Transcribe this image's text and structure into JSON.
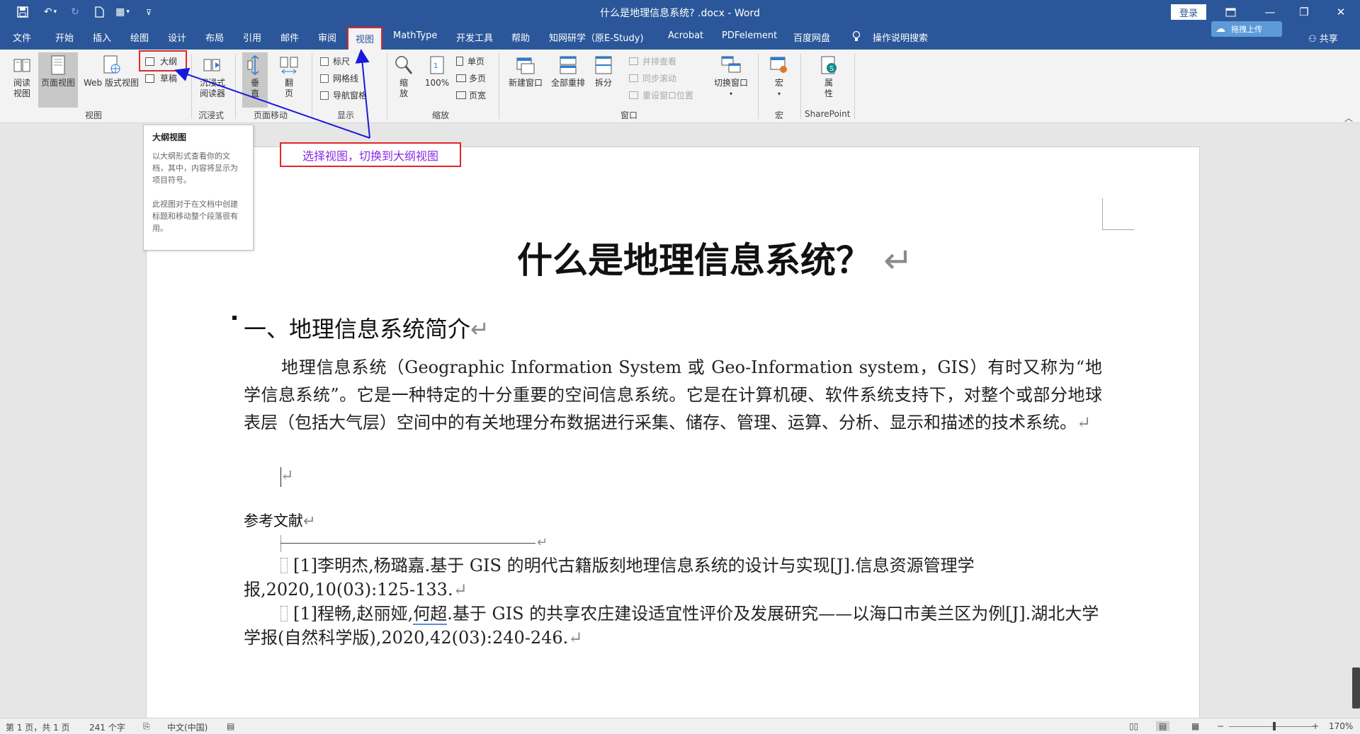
{
  "window": {
    "title": "什么是地理信息系统? .docx - Word",
    "login_label": "登录",
    "upload_label": "拖拽上传",
    "share_label": "共享"
  },
  "tabs": [
    {
      "label": "文件"
    },
    {
      "label": "开始"
    },
    {
      "label": "插入"
    },
    {
      "label": "绘图"
    },
    {
      "label": "设计"
    },
    {
      "label": "布局"
    },
    {
      "label": "引用"
    },
    {
      "label": "邮件"
    },
    {
      "label": "审阅"
    },
    {
      "label": "视图",
      "active": true
    },
    {
      "label": "MathType"
    },
    {
      "label": "开发工具"
    },
    {
      "label": "帮助"
    },
    {
      "label": "知网研学（原E-Study)"
    },
    {
      "label": "Acrobat"
    },
    {
      "label": "PDFelement"
    },
    {
      "label": "百度网盘"
    },
    {
      "label": "操作说明搜索"
    }
  ],
  "ribbon": {
    "views": {
      "read_mode": "阅读视图",
      "print_layout": "页面视图",
      "web_layout": "Web 版式视图",
      "outline": "大纲",
      "draft": "草稿",
      "group": "视图"
    },
    "immersive": {
      "reader": "沉浸式阅读器",
      "group": "沉浸式"
    },
    "page_movement": {
      "vertical": "垂直",
      "side_to_side": "翻页",
      "group": "页面移动"
    },
    "show": {
      "ruler": "标尺",
      "gridlines": "网格线",
      "nav_pane": "导航窗格",
      "group": "显示"
    },
    "zoom": {
      "zoom": "缩放",
      "hundred": "100%",
      "one_page": "单页",
      "multi_page": "多页",
      "page_width": "页宽",
      "group": "缩放"
    },
    "window": {
      "new_window": "新建窗口",
      "arrange_all": "全部重排",
      "split": "拆分",
      "side_by_side": "并排查看",
      "sync_scroll": "同步滚动",
      "reset_pos": "重设窗口位置",
      "switch_windows": "切换窗口",
      "group": "窗口"
    },
    "macros": {
      "macros": "宏",
      "group": "宏"
    },
    "sharepoint": {
      "properties": "属性",
      "group": "SharePoint"
    }
  },
  "tooltip": {
    "title": "大纲视图",
    "body1": "以大纲形式查看你的文档，其中，内容将显示为项目符号。",
    "body2": "此视图对于在文档中创建标题和移动整个段落很有用。"
  },
  "callout": "选择视图，切换到大纲视图",
  "document": {
    "title": "什么是地理信息系统？",
    "heading": "一、地理信息系统简介",
    "paragraph": "地理信息系统（Geographic Information System 或 Geo-Information system，GIS）有时又称为“地学信息系统”。它是一种特定的十分重要的空间信息系统。它是在计算机硬、软件系统支持下，对整个或部分地球表层（包括大气层）空间中的有关地理分布数据进行采集、储存、管理、运算、分析、显示和描述的技术系统。",
    "ref_heading": "参考文献",
    "ref1": "[1]李明杰,杨璐嘉.基于 GIS 的明代古籍版刻地理信息系统的设计与实现[J].信息资源管理学报,2020,10(03):125-133.",
    "ref2_pre": "[1]程畅,赵丽娅,",
    "ref2_under": "何超",
    "ref2_post": ".基于 GIS 的共享农庄建设适宜性评价及发展研究——以海口市美兰区为例[J].湖北大学学报(自然科学版),2020,42(03):240-246."
  },
  "status": {
    "page": "第 1 页，共 1 页",
    "words": "241 个字",
    "language": "中文(中国)",
    "zoom": "170%"
  },
  "colors": {
    "accent": "#2b579a",
    "highlight": "#e0262b",
    "callout_text": "#8a2be2",
    "arrow": "#1a1adc"
  }
}
